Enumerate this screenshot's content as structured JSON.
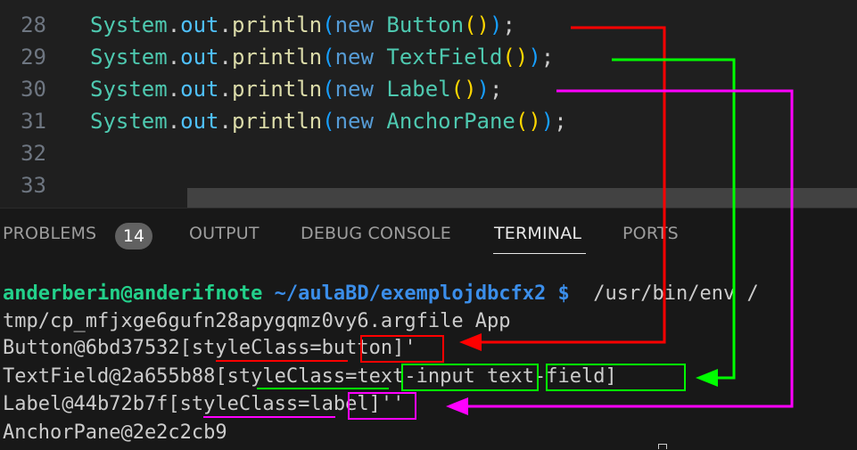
{
  "editor": {
    "lines": [
      {
        "num": "28",
        "tokens": [
          {
            "t": "System",
            "c": "t-cls"
          },
          {
            "t": ".",
            "c": "t-dot"
          },
          {
            "t": "out",
            "c": "t-fld"
          },
          {
            "t": ".",
            "c": "t-dot"
          },
          {
            "t": "println",
            "c": "t-fn"
          },
          {
            "t": "(",
            "c": "t-p1"
          },
          {
            "t": "new ",
            "c": "t-new"
          },
          {
            "t": "Button",
            "c": "t-cls"
          },
          {
            "t": "()",
            "c": "t-p2"
          },
          {
            "t": ")",
            "c": "t-p1"
          },
          {
            "t": ";",
            "c": "t-semi"
          }
        ]
      },
      {
        "num": "29",
        "tokens": [
          {
            "t": "System",
            "c": "t-cls"
          },
          {
            "t": ".",
            "c": "t-dot"
          },
          {
            "t": "out",
            "c": "t-fld"
          },
          {
            "t": ".",
            "c": "t-dot"
          },
          {
            "t": "println",
            "c": "t-fn"
          },
          {
            "t": "(",
            "c": "t-p1"
          },
          {
            "t": "new ",
            "c": "t-new"
          },
          {
            "t": "TextField",
            "c": "t-cls"
          },
          {
            "t": "()",
            "c": "t-p2"
          },
          {
            "t": ")",
            "c": "t-p1"
          },
          {
            "t": ";",
            "c": "t-semi"
          }
        ]
      },
      {
        "num": "30",
        "tokens": [
          {
            "t": "System",
            "c": "t-cls"
          },
          {
            "t": ".",
            "c": "t-dot"
          },
          {
            "t": "out",
            "c": "t-fld"
          },
          {
            "t": ".",
            "c": "t-dot"
          },
          {
            "t": "println",
            "c": "t-fn"
          },
          {
            "t": "(",
            "c": "t-p1"
          },
          {
            "t": "new ",
            "c": "t-new"
          },
          {
            "t": "Label",
            "c": "t-cls"
          },
          {
            "t": "()",
            "c": "t-p2"
          },
          {
            "t": ")",
            "c": "t-p1"
          },
          {
            "t": ";",
            "c": "t-semi"
          }
        ]
      },
      {
        "num": "31",
        "tokens": [
          {
            "t": "System",
            "c": "t-cls"
          },
          {
            "t": ".",
            "c": "t-dot"
          },
          {
            "t": "out",
            "c": "t-fld"
          },
          {
            "t": ".",
            "c": "t-dot"
          },
          {
            "t": "println",
            "c": "t-fn"
          },
          {
            "t": "(",
            "c": "t-p1"
          },
          {
            "t": "new ",
            "c": "t-new"
          },
          {
            "t": "AnchorPane",
            "c": "t-cls"
          },
          {
            "t": "()",
            "c": "t-p2"
          },
          {
            "t": ")",
            "c": "t-p1"
          },
          {
            "t": ";",
            "c": "t-semi"
          }
        ]
      },
      {
        "num": "32",
        "tokens": []
      },
      {
        "num": "33",
        "tokens": []
      }
    ]
  },
  "panel": {
    "tabs": {
      "problems": "PROBLEMS",
      "problems_count": "14",
      "output": "OUTPUT",
      "debug_console": "DEBUG CONSOLE",
      "terminal": "TERMINAL",
      "ports": "PORTS"
    },
    "terminal": {
      "prompt_user": "anderberin@anderifnote",
      "prompt_path": " ~/aulaBD/exemplojdbcfx2",
      "prompt_symbol": " $",
      "command": "  /usr/bin/env /",
      "command_cont": "tmp/cp_mfjxge6gufn28apygqmz0vy6.argfile App",
      "out_button": "Button@6bd37532[styleClass=button]'",
      "out_textfield": "TextField@2a655b88[styleClass=text-input text-field]",
      "out_label": "Label@44b72b7f[styleClass=label]''",
      "out_anchorpane": "AnchorPane@2e2c2cb9"
    }
  },
  "annotation_colors": {
    "button": "#ff0000",
    "textfield": "#00ff00",
    "label": "#ff00ff"
  }
}
